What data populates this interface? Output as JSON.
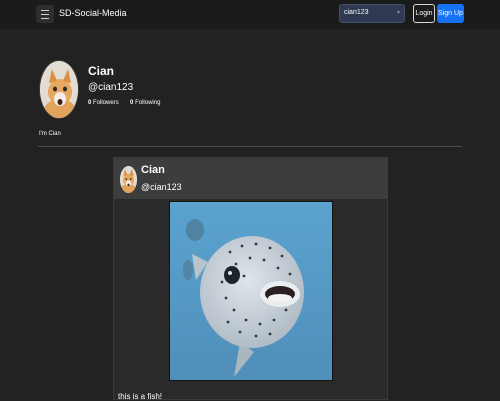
{
  "navbar": {
    "brand": "SD-Social-Media",
    "search_value": "cian123",
    "login_label": "Login",
    "signup_label": "Sign Up"
  },
  "profile": {
    "name": "Cian",
    "handle": "@cian123",
    "followers_count": "0",
    "followers_label": "Followers",
    "following_count": "0",
    "following_label": "Following",
    "bio": "I'm Cian"
  },
  "post": {
    "author_name": "Cian",
    "author_handle": "@cian123",
    "text": "this is a fish!"
  },
  "colors": {
    "background": "#222222",
    "navbar": "#1b1b1b",
    "signup_button": "#1672f3",
    "post_header": "#3d3d3d",
    "post_body": "#2a2a2a"
  },
  "icons": {
    "menu": "hamburger-menu-icon",
    "search_caret": "chevron-down-icon"
  }
}
